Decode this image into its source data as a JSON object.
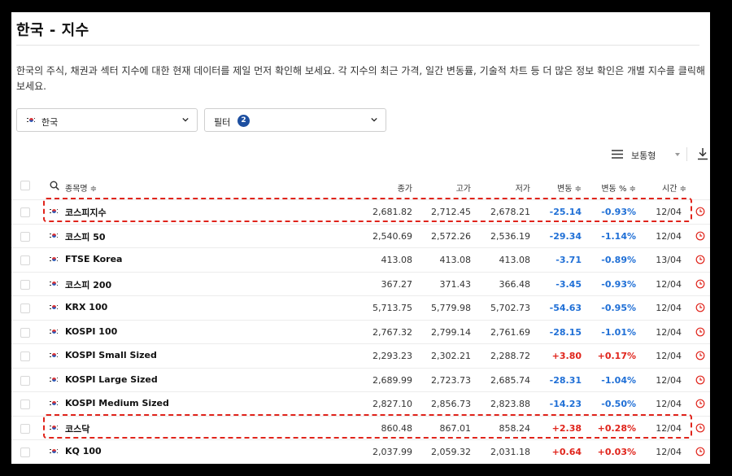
{
  "page": {
    "title": "한국 - 지수",
    "description": "한국의 주식, 채권과 섹터 지수에 대한 현재 데이터를 제일 먼저 확인해 보세요. 각 지수의 최근 가격, 일간 변동률, 기술적 차트 등 더 많은 정보 확인은 개별 지수를 클릭해 보세요."
  },
  "filters": {
    "country": "한국",
    "filter_label": "필터",
    "filter_count": "2"
  },
  "toolbar": {
    "view_label": "보통형"
  },
  "table": {
    "headers": {
      "name": "종목명 ≑",
      "close": "종가",
      "high": "고가",
      "low": "저가",
      "change": "변동 ≑",
      "change_pct": "변동 % ≑",
      "time": "시간 ≑"
    },
    "rows": [
      {
        "name": "코스피지수",
        "close": "2,681.82",
        "high": "2,712.45",
        "low": "2,678.21",
        "change": "-25.14",
        "change_pct": "-0.93%",
        "time": "12/04"
      },
      {
        "name": "코스피 50",
        "close": "2,540.69",
        "high": "2,572.26",
        "low": "2,536.19",
        "change": "-29.34",
        "change_pct": "-1.14%",
        "time": "12/04"
      },
      {
        "name": "FTSE Korea",
        "close": "413.08",
        "high": "413.08",
        "low": "413.08",
        "change": "-3.71",
        "change_pct": "-0.89%",
        "time": "13/04"
      },
      {
        "name": "코스피 200",
        "close": "367.27",
        "high": "371.43",
        "low": "366.48",
        "change": "-3.45",
        "change_pct": "-0.93%",
        "time": "12/04"
      },
      {
        "name": "KRX 100",
        "close": "5,713.75",
        "high": "5,779.98",
        "low": "5,702.73",
        "change": "-54.63",
        "change_pct": "-0.95%",
        "time": "12/04"
      },
      {
        "name": "KOSPI 100",
        "close": "2,767.32",
        "high": "2,799.14",
        "low": "2,761.69",
        "change": "-28.15",
        "change_pct": "-1.01%",
        "time": "12/04"
      },
      {
        "name": "KOSPI Small Sized",
        "close": "2,293.23",
        "high": "2,302.21",
        "low": "2,288.72",
        "change": "+3.80",
        "change_pct": "+0.17%",
        "time": "12/04"
      },
      {
        "name": "KOSPI Large Sized",
        "close": "2,689.99",
        "high": "2,723.73",
        "low": "2,685.74",
        "change": "-28.31",
        "change_pct": "-1.04%",
        "time": "12/04"
      },
      {
        "name": "KOSPI Medium Sized",
        "close": "2,827.10",
        "high": "2,856.73",
        "low": "2,823.88",
        "change": "-14.23",
        "change_pct": "-0.50%",
        "time": "12/04"
      },
      {
        "name": "코스닥",
        "close": "860.48",
        "high": "867.01",
        "low": "858.24",
        "change": "+2.38",
        "change_pct": "+0.28%",
        "time": "12/04"
      },
      {
        "name": "KQ 100",
        "close": "2,037.99",
        "high": "2,059.32",
        "low": "2,031.18",
        "change": "+0.64",
        "change_pct": "+0.03%",
        "time": "12/04"
      }
    ]
  },
  "colors": {
    "negative": "#1f6fd6",
    "positive": "#e0241b",
    "highlight_border": "#e0241b",
    "badge": "#1d4fa0"
  }
}
